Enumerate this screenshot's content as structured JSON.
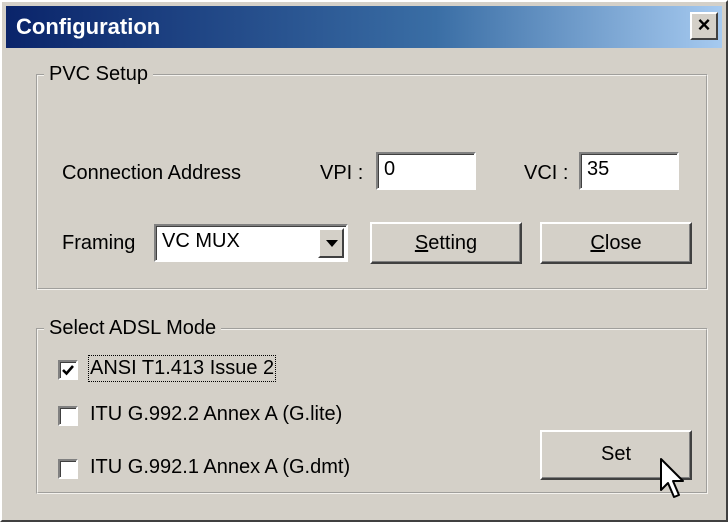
{
  "window": {
    "title": "Configuration",
    "close_glyph": "×"
  },
  "pvc": {
    "group_title": "PVC Setup",
    "connection_label": "Connection Address",
    "vpi_label": "VPI :",
    "vpi_value": "0",
    "vci_label": "VCI :",
    "vci_value": "35",
    "framing_label": "Framing",
    "framing_value": "VC MUX",
    "setting_button": {
      "access_key": "S",
      "rest": "etting"
    },
    "close_button": {
      "access_key": "C",
      "rest": "lose"
    }
  },
  "adsl": {
    "group_title": "Select ADSL Mode",
    "options": [
      {
        "label": "ANSI T1.413 Issue 2",
        "checked": true
      },
      {
        "label": "ITU G.992.2 Annex A (G.lite)",
        "checked": false
      },
      {
        "label": "ITU G.992.1 Annex A (G.dmt)",
        "checked": false
      }
    ],
    "set_button": "Set"
  },
  "icons": [
    "close-icon",
    "dropdown-arrow-icon",
    "checkmark-icon",
    "mouse-pointer-icon"
  ]
}
